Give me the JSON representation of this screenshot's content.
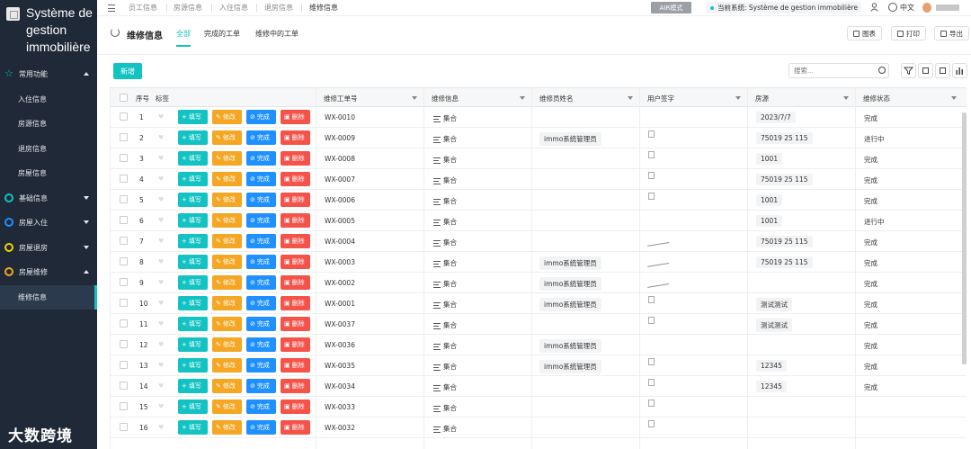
{
  "sidebar": {
    "brand_title": "Système de gestion immobilière",
    "groups": [
      {
        "label": "常用功能",
        "icon": "star-icon",
        "expanded": true,
        "items": [
          {
            "label": "入住信息"
          },
          {
            "label": "房源信息"
          },
          {
            "label": "退房信息"
          },
          {
            "label": "房屋信息"
          }
        ]
      },
      {
        "label": "基础信息",
        "icon": "circle-icon",
        "expanded": false
      },
      {
        "label": "房屋入住",
        "icon": "circle-icon",
        "expanded": false
      },
      {
        "label": "房屋退房",
        "icon": "circle-icon",
        "expanded": false
      },
      {
        "label": "房屋维修",
        "icon": "circle-icon",
        "expanded": true,
        "items": [
          {
            "label": "维修信息",
            "active": true
          }
        ]
      }
    ],
    "watermark": "大数跨境"
  },
  "topbar": {
    "nav": [
      "员工信息",
      "房源信息",
      "入住信息",
      "退房信息",
      "维修信息"
    ],
    "air_mode": "AIR模式",
    "current_system": "当前系统: Système de gestion immobilière",
    "language": "中文"
  },
  "titlebar": {
    "title": "维修信息",
    "tabs": [
      "全部",
      "完成的工单",
      "维修中的工单"
    ],
    "active_tab": "全部",
    "buttons": {
      "chart": "图表",
      "print": "打印",
      "export": "导出"
    }
  },
  "toolbar": {
    "new_label": "新增",
    "search_placeholder": "搜索..."
  },
  "table": {
    "headers": {
      "index": "序号",
      "tag": "标签",
      "order": "维修工单号",
      "info": "维修信息",
      "staff": "维修员姓名",
      "sign": "用户签字",
      "house": "房源",
      "status": "维修状态"
    },
    "actions": {
      "fill": "填写",
      "edit": "修改",
      "done": "完成",
      "delete": "删除"
    },
    "info_value": "集合",
    "rows": [
      {
        "no": "1",
        "order": "WX-0010",
        "staff": "",
        "sign": "none",
        "house": "2023/7/7",
        "status": "完成"
      },
      {
        "no": "2",
        "order": "WX-0009",
        "staff": "immo系统管理员",
        "sign": "img",
        "house": "75019 25 115",
        "status": "进行中"
      },
      {
        "no": "3",
        "order": "WX-0008",
        "staff": "",
        "sign": "img",
        "house": "1001",
        "status": "完成"
      },
      {
        "no": "4",
        "order": "WX-0007",
        "staff": "",
        "sign": "img",
        "house": "75019 25 115",
        "status": "完成"
      },
      {
        "no": "5",
        "order": "WX-0006",
        "staff": "",
        "sign": "img",
        "house": "1001",
        "status": "完成"
      },
      {
        "no": "6",
        "order": "WX-0005",
        "staff": "",
        "sign": "none",
        "house": "1001",
        "status": "进行中"
      },
      {
        "no": "7",
        "order": "WX-0004",
        "staff": "",
        "sign": "scribble",
        "house": "75019 25 115",
        "status": "完成"
      },
      {
        "no": "8",
        "order": "WX-0003",
        "staff": "immo系统管理员",
        "sign": "scribble",
        "house": "75019 25 115",
        "status": "完成"
      },
      {
        "no": "9",
        "order": "WX-0002",
        "staff": "immo系统管理员",
        "sign": "scribble",
        "house": "",
        "status": "完成"
      },
      {
        "no": "10",
        "order": "WX-0001",
        "staff": "immo系统管理员",
        "sign": "img",
        "house": "测试测试",
        "status": "完成"
      },
      {
        "no": "11",
        "order": "WX-0037",
        "staff": "",
        "sign": "img",
        "house": "测试测试",
        "status": "完成"
      },
      {
        "no": "12",
        "order": "WX-0036",
        "staff": "immo系统管理员",
        "sign": "none",
        "house": "",
        "status": "完成"
      },
      {
        "no": "13",
        "order": "WX-0035",
        "staff": "immo系统管理员",
        "sign": "img",
        "house": "12345",
        "status": "完成"
      },
      {
        "no": "14",
        "order": "WX-0034",
        "staff": "",
        "sign": "img",
        "house": "12345",
        "status": "完成"
      },
      {
        "no": "15",
        "order": "WX-0033",
        "staff": "",
        "sign": "img",
        "house": "",
        "status": ""
      },
      {
        "no": "16",
        "order": "WX-0032",
        "staff": "",
        "sign": "img",
        "house": "",
        "status": ""
      }
    ]
  },
  "colors": {
    "accent": "#13c2c2",
    "fill": "#13c2c2",
    "edit": "#f5a623",
    "done": "#1e90ff",
    "delete": "#f5534a",
    "sidebar": "#1f2937"
  }
}
